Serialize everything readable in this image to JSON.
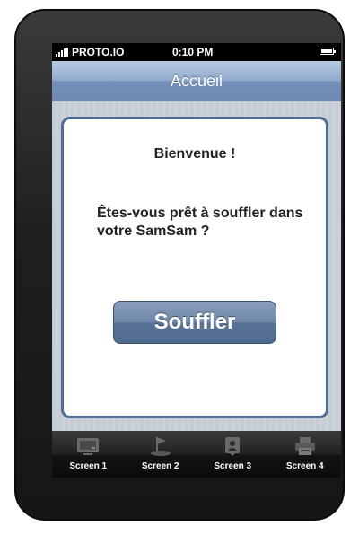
{
  "status_bar": {
    "carrier": "PROTO.IO",
    "time": "0:10 PM",
    "icons": [
      "signal-bars-icon",
      "battery-icon"
    ]
  },
  "nav_bar": {
    "title": "Accueil"
  },
  "card": {
    "title": "Bienvenue !",
    "message": "Êtes-vous prêt à souffler dans votre SamSam ?",
    "button_label": "Souffler"
  },
  "tab_bar": {
    "items": [
      {
        "label": "Screen 1",
        "icon": "monitor-icon"
      },
      {
        "label": "Screen 2",
        "icon": "golf-icon"
      },
      {
        "label": "Screen 3",
        "icon": "person-badge-icon"
      },
      {
        "label": "Screen 4",
        "icon": "printer-icon"
      }
    ]
  },
  "colors": {
    "nav_bar_blue": "#7390b8",
    "card_border": "#4f6e95",
    "button_blue": "#5a7396",
    "tab_bar_dark": "#141414",
    "device_body": "#1f1f1f"
  }
}
